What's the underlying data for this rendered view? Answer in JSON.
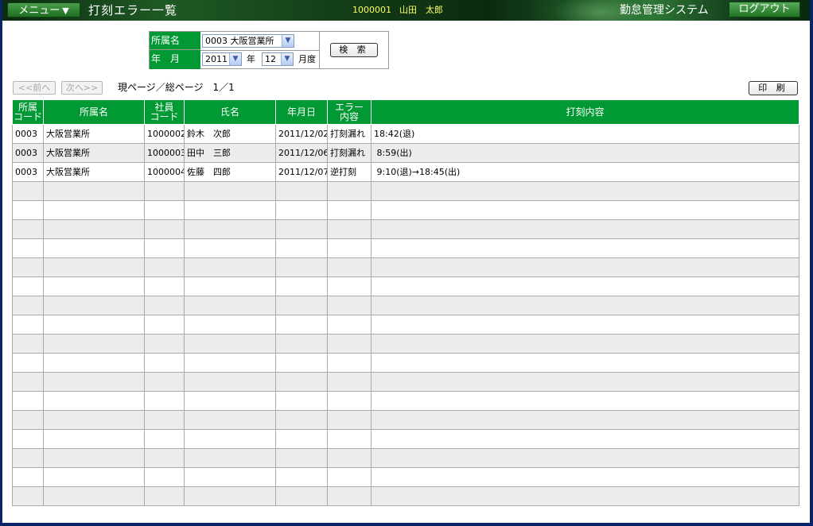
{
  "header": {
    "menu_label": "メニュー",
    "menu_arrow": "▼",
    "page_title": "打刻エラー一覧",
    "user_id": "1000001",
    "user_name": "山田　太郎",
    "system_name": "勤怠管理システム",
    "logout_label": "ログアウト"
  },
  "search": {
    "dept_label": "所属名",
    "period_label": "年　月",
    "dept_value": "0003 大阪営業所",
    "year_value": "2011",
    "year_unit": "年",
    "month_value": "12",
    "month_unit": "月度",
    "search_button": "検 索"
  },
  "pager": {
    "prev_label": "<<前へ",
    "next_label": "次へ>>",
    "page_info": "現ページ／総ページ　1／1",
    "print_button": "印 刷"
  },
  "table": {
    "headers": [
      "所属\nコード",
      "所属名",
      "社員\nコード",
      "氏名",
      "年月日",
      "エラー\n内容",
      "打刻内容"
    ],
    "rows": [
      [
        "0003",
        "大阪営業所",
        "1000002",
        "鈴木　次郎",
        "2011/12/02",
        "打刻漏れ",
        "18:42(退)"
      ],
      [
        "0003",
        "大阪営業所",
        "1000003",
        "田中　三郎",
        "2011/12/06",
        "打刻漏れ",
        " 8:59(出)"
      ],
      [
        "0003",
        "大阪営業所",
        "1000004",
        "佐藤　四郎",
        "2011/12/07",
        "逆打刻",
        " 9:10(退)→18:45(出)"
      ]
    ],
    "total_rows": 20
  },
  "colors": {
    "header_green": "#009933",
    "user_info_text": "#ffff66",
    "row_alt": "#ececec"
  }
}
